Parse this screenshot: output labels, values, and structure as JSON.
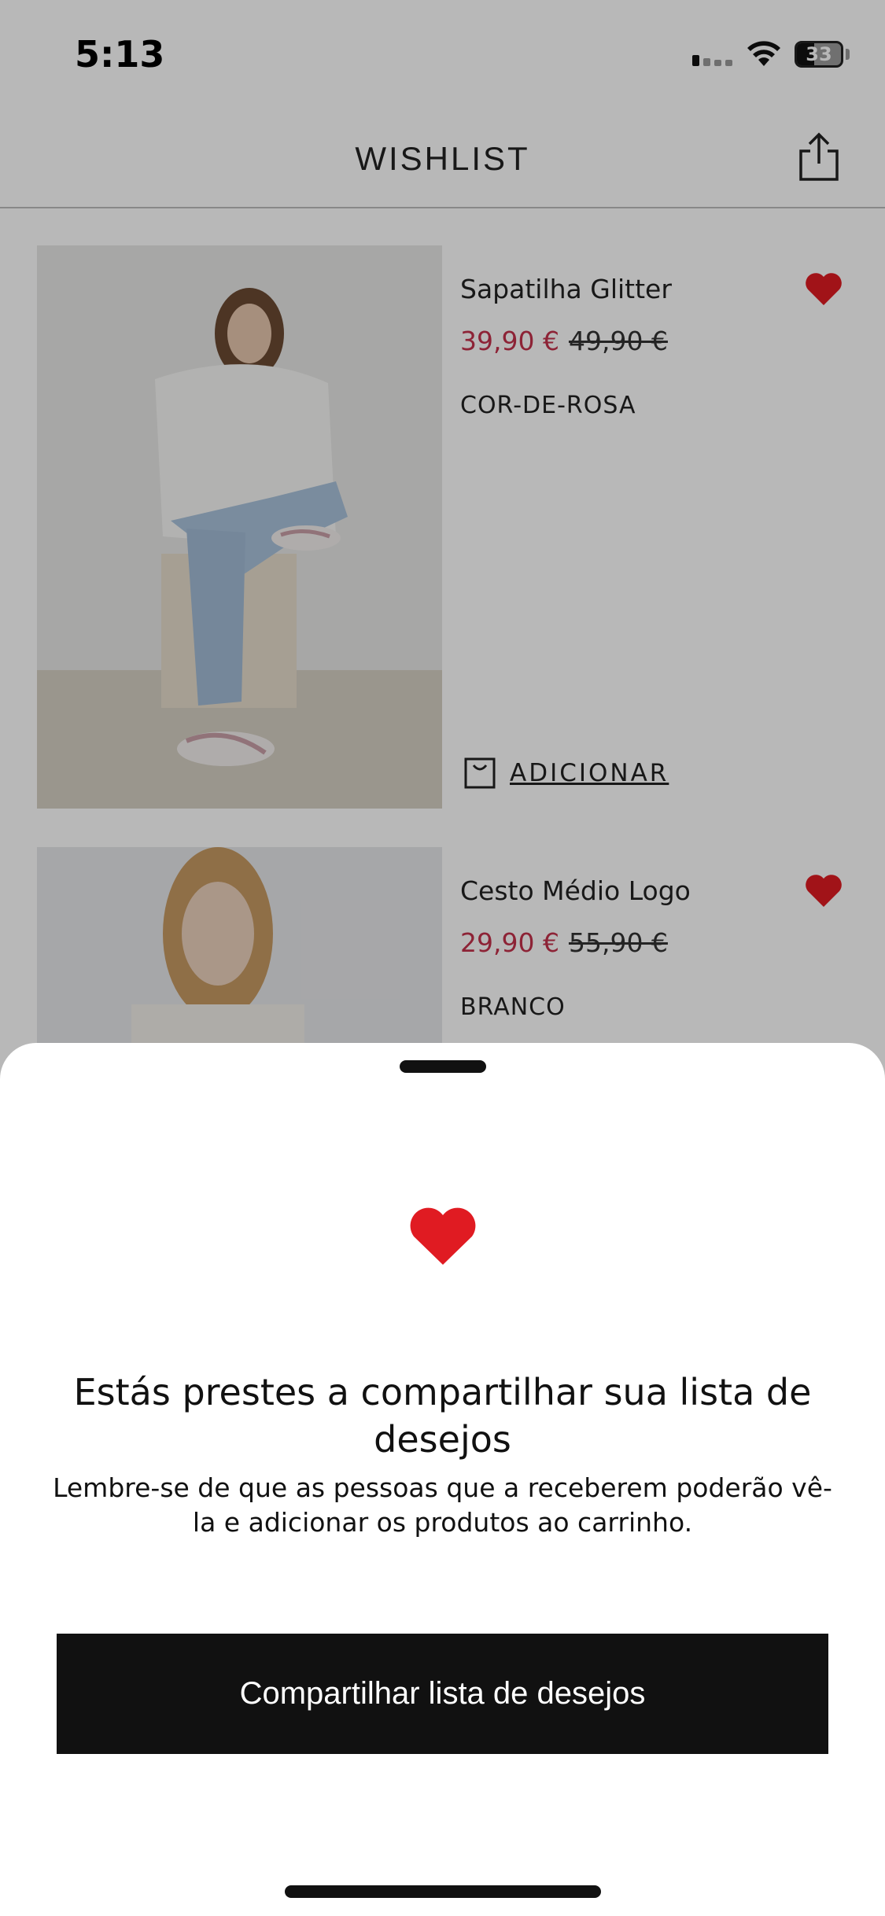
{
  "status_bar": {
    "time": "5:13",
    "battery": "33"
  },
  "header": {
    "title": "WISHLIST",
    "share_icon": "share-icon"
  },
  "products": [
    {
      "name": "Sapatilha Glitter",
      "price": "39,90 €",
      "old_price": "49,90 €",
      "color": "COR-DE-ROSA",
      "add_label": "ADICIONAR"
    },
    {
      "name": "Cesto Médio Logo",
      "price": "29,90 €",
      "old_price": "55,90 €",
      "color": "BRANCO"
    }
  ],
  "sheet": {
    "title": "Estás prestes a compartilhar sua lista de desejos",
    "body": "Lembre-se de que as pessoas que a receberem poderão vê-la e adicionar os produtos ao carrinho.",
    "cta": "Compartilhar lista de desejos"
  },
  "colors": {
    "sale": "#c4314b",
    "heart": "#e01b22",
    "cta_background": "#111111"
  }
}
